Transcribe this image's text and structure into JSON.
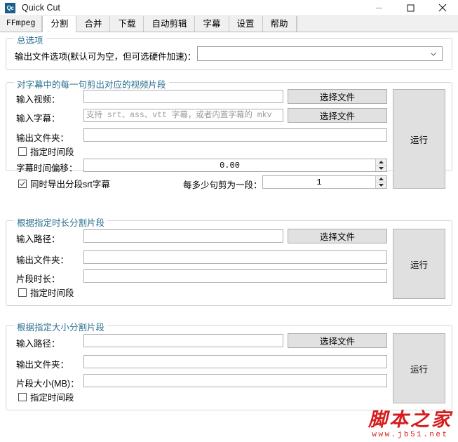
{
  "window": {
    "icon_text": "Qc",
    "title": "Quick Cut",
    "minimize_label": "—",
    "maximize_label": "□",
    "close_label": "✕"
  },
  "tabs": [
    {
      "label": "FFmpeg",
      "active": false
    },
    {
      "label": "分割",
      "active": true
    },
    {
      "label": "合并",
      "active": false
    },
    {
      "label": "下载",
      "active": false
    },
    {
      "label": "自动剪辑",
      "active": false
    },
    {
      "label": "字幕",
      "active": false
    },
    {
      "label": "设置",
      "active": false
    },
    {
      "label": "帮助",
      "active": false
    }
  ],
  "groups": {
    "general": {
      "title": "总选项",
      "output_options_label": "输出文件选项(默认可为空，但可选硬件加速)：",
      "output_options_value": "",
      "dropdown_icon": "chevron-down-icon"
    },
    "subtitle_cut": {
      "title": "对字幕中的每一句剪出对应的视频片段",
      "input_video_label": "输入视频：",
      "input_video_value": "",
      "input_video_button": "选择文件",
      "input_subtitle_label": "输入字幕：",
      "input_subtitle_value": "",
      "input_subtitle_placeholder": "支持 srt、ass、vtt 字幕，或者内置字幕的 mkv",
      "input_subtitle_button": "选择文件",
      "output_folder_label": "输出文件夹：",
      "output_folder_value": "",
      "time_range_checkbox_label": "指定时间段",
      "time_range_checked": false,
      "subtitle_offset_label": "字幕时间偏移：",
      "subtitle_offset_value": "0.00",
      "export_srt_checkbox_label": "同时导出分段srt字幕",
      "export_srt_checked": true,
      "sentences_per_clip_label": "每多少句剪为一段：",
      "sentences_per_clip_value": "1",
      "run_button": "运行"
    },
    "duration_split": {
      "title": "根据指定时长分割片段",
      "input_path_label": "输入路径：",
      "input_path_value": "",
      "input_path_button": "选择文件",
      "output_folder_label": "输出文件夹：",
      "output_folder_value": "",
      "clip_duration_label": "片段时长：",
      "clip_duration_value": "",
      "time_range_checkbox_label": "指定时间段",
      "time_range_checked": false,
      "run_button": "运行"
    },
    "size_split": {
      "title": "根据指定大小分割片段",
      "input_path_label": "输入路径：",
      "input_path_value": "",
      "input_path_button": "选择文件",
      "output_folder_label": "输出文件夹：",
      "output_folder_value": "",
      "clip_size_label": "片段大小(MB)：",
      "clip_size_value": "",
      "time_range_checkbox_label": "指定时间段",
      "time_range_checked": false,
      "run_button": "运行"
    }
  },
  "watermark": {
    "main": "脚本之家",
    "sub": "www.jb51.net",
    "color": "#d61c1c"
  },
  "colors": {
    "group_title": "#2a6e8f",
    "button_face": "#e1e1e1",
    "tab_inactive": "#f0f0f0",
    "field_border": "#aeaeae"
  }
}
